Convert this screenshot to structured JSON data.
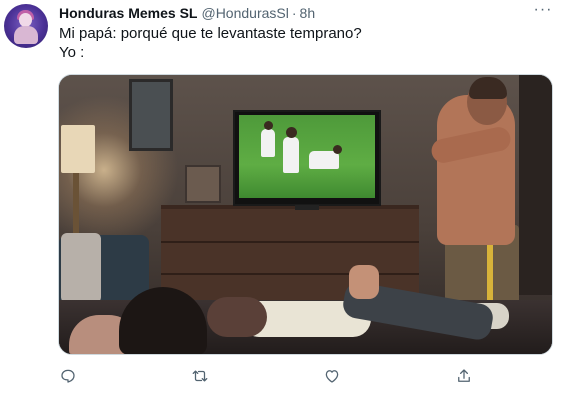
{
  "tweet": {
    "author_name": "Honduras Memes SL",
    "author_handle": "@HondurasSl",
    "separator": "·",
    "time": "8h",
    "more_label": "···",
    "text_lines": [
      "Mi papá: porqué que te levantaste temprano?",
      "Yo :"
    ]
  },
  "icons": {
    "reply": "reply-icon",
    "retweet": "retweet-icon",
    "like": "like-icon",
    "share": "share-icon"
  },
  "colors": {
    "secondary_text": "#536471",
    "primary_text": "#0f1419",
    "border": "#cfd9de"
  }
}
